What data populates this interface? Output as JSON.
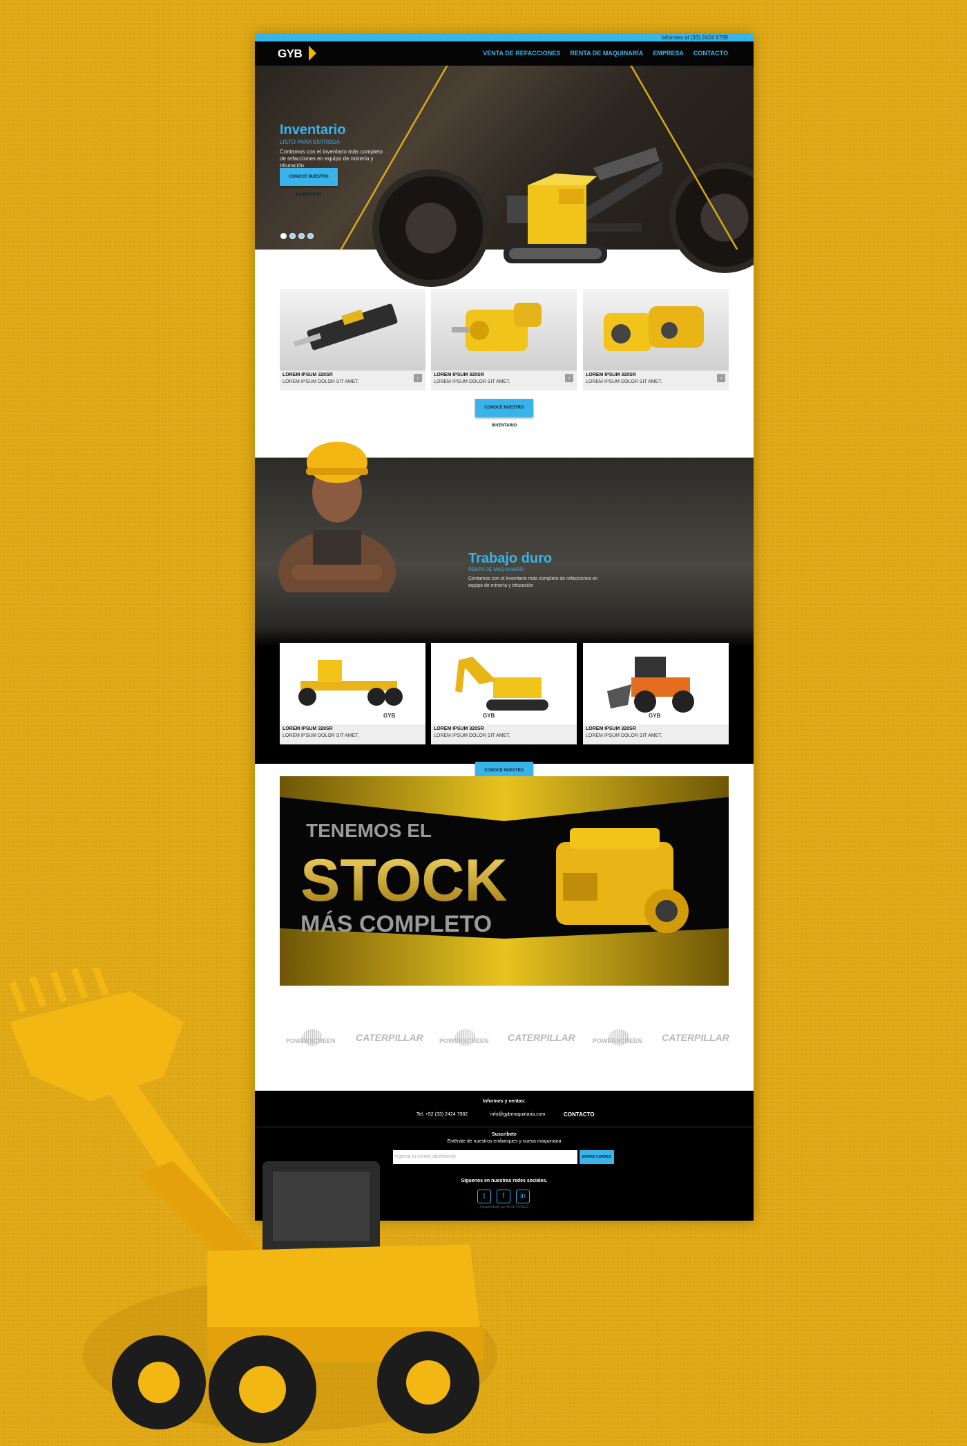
{
  "header": {
    "topbar_text": "Informes al (33) 2424 6789",
    "logo_text": "GYB",
    "nav": [
      "VENTA DE REFACCIONES",
      "RENTA DE MAQUINARÍA",
      "EMPRESA",
      "CONTACTO"
    ]
  },
  "hero": {
    "title": "Inventario",
    "subtitle": "LISTO PARA ENTREGA",
    "description": "Contamos con el inventario más completo de refacciones en equipo de minería y trituración",
    "button": "CONOCE NUESTRO INVENTARIO"
  },
  "parts": {
    "cards": [
      {
        "title": "LOREM IPSUM 320SR",
        "text": "LOREM IPSUM DOLOR SIT AMET.",
        "arrow": "›"
      },
      {
        "title": "LOREM IPSUM 320SR",
        "text": "LOREM IPSUM DOLOR SIT AMET.",
        "arrow": "›"
      },
      {
        "title": "LOREM IPSUM 320SR",
        "text": "LOREM IPSUM DOLOR SIT AMET.",
        "arrow": "›"
      }
    ],
    "button": "CONOCE NUESTRO INVENTARIO"
  },
  "rental": {
    "title": "Trabajo duro",
    "subtitle": "RENTA DE MAQUINARÍA",
    "description": "Contamos con el inventario más completo de refacciones en equipo de minería y trituración",
    "cards": [
      {
        "title": "LOREM IPSUM 320SR",
        "text": "LOREM IPSUM DOLOR SIT AMET.",
        "watermark": "GYB"
      },
      {
        "title": "LOREM IPSUM 320SR",
        "text": "LOREM IPSUM DOLOR SIT AMET.",
        "watermark": "GYB"
      },
      {
        "title": "LOREM IPSUM 320SR",
        "text": "LOREM IPSUM DOLOR SIT AMET.",
        "watermark": "GYB"
      }
    ],
    "button": "CONOCE NUESTRO INVENTARIO"
  },
  "banner": {
    "line1": "TENEMOS EL",
    "line2": "STOCK",
    "line3": "MÁS COMPLETO"
  },
  "brands": {
    "powerscreen": "POWERSCREEN",
    "caterpillar": "CATERPILLAR"
  },
  "footer": {
    "contact_heading": "Informes y ventas:",
    "phone": "Tel. +52 (33) 2424 7982",
    "email": "info@gybmaquinaria.com",
    "contact_link": "CONTACTO",
    "subscribe_heading": "Suscríbete",
    "subscribe_text": "Entérate de nuestros embarques y nueva maquinaria",
    "email_placeholder": "Ingresa tu correo electrónico",
    "send_button": "ENVIAR CORREO",
    "social_heading": "Síguenos en nuestras redes sociales.",
    "social": [
      "twitter",
      "facebook",
      "linkedin"
    ],
    "credit": "Desarrollado por BLUETOWER"
  },
  "colors": {
    "accent_blue": "#39b4ea",
    "brand_yellow": "#e0a814"
  }
}
